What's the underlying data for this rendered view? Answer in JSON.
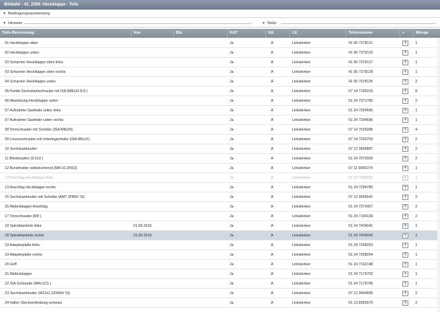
{
  "window": {
    "title": "Bildtafel - 41_2359: Heckklappe - Teile"
  },
  "sections": {
    "conditions": "Bedingungsauswertung",
    "note_left": "Hinweis",
    "note_right": "Notiz"
  },
  "columns": [
    "Teile-Benennung",
    "Von",
    "Bis",
    "KAT",
    "GE",
    "LE",
    "Teilenummer",
    "+",
    "Menge"
  ],
  "rows": [
    {
      "name": "01 Heckklappe oben",
      "von": "",
      "bis": "",
      "kat": "Ja",
      "ge": "A",
      "le": "Linkslenker",
      "nr": "41 00 7378121",
      "menge": "1"
    },
    {
      "name": "02 Heckklappe unten",
      "von": "",
      "bis": "",
      "kat": "Ja",
      "ge": "A",
      "le": "Linkslenker",
      "nr": "41 00 7379123",
      "menge": "1"
    },
    {
      "name": "03 Scharnier Heckklappe oben links",
      "von": "",
      "bis": "",
      "kat": "Ja",
      "ge": "A",
      "le": "Linkslenker",
      "nr": "41 00 7378127",
      "menge": "1"
    },
    {
      "name": "03 Scharnier Heckklappe oben rechts",
      "von": "",
      "bis": "",
      "kat": "Ja",
      "ge": "A",
      "le": "Linkslenker",
      "nr": "41 00 7378128",
      "menge": "1"
    },
    {
      "name": "04 Scharnier Heckklappe unten",
      "von": "",
      "bis": "",
      "kat": "Ja",
      "ge": "A",
      "le": "Linkslenker",
      "nr": "41 00 7378126",
      "menge": "2"
    },
    {
      "name": "05 Kombi-Sechskantschraube mit ISA (M8x32-8.8 )",
      "von": "",
      "bis": "",
      "kat": "Ja",
      "ge": "A",
      "le": "Linkslenker",
      "nr": "07 14 7195315",
      "menge": "8"
    },
    {
      "name": "06 Abstützung Heckklappe unten",
      "von": "",
      "bis": "",
      "kat": "Ja",
      "ge": "A",
      "le": "Linkslenker",
      "nr": "51 24 7371785",
      "menge": "2"
    },
    {
      "name": "07 Aufnahme Gasfeder unten links",
      "von": "",
      "bis": "",
      "kat": "Ja",
      "ge": "A",
      "le": "Linkslenker",
      "nr": "51 24 7294595",
      "menge": "1"
    },
    {
      "name": "07 Aufnahme Gasfeder unten rechts",
      "von": "",
      "bis": "",
      "kat": "Ja",
      "ge": "A",
      "le": "Linkslenker",
      "nr": "51 24 7294596",
      "menge": "1"
    },
    {
      "name": "08 Torxschraube mit Scheibe (ISA M8x20)",
      "von": "",
      "bis": "",
      "kat": "Ja",
      "ge": "A",
      "le": "Linkslenker",
      "nr": "07 14 7026396",
      "menge": "4"
    },
    {
      "name": "09 Linsenschraube mit Unterlegscheibe (ISA M6x21)",
      "von": "",
      "bis": "",
      "kat": "Ja",
      "ge": "A",
      "le": "Linkslenker",
      "nr": "07 14 7263759",
      "menge": "2"
    },
    {
      "name": "10 Sechskantmutter",
      "von": "",
      "bis": "",
      "kat": "Ja",
      "ge": "A",
      "le": "Linkslenker",
      "nr": "07 12 9906887",
      "menge": "2"
    },
    {
      "name": "11 Blindstopfen (9,5x3 )",
      "von": "",
      "bis": "",
      "kat": "Ja",
      "ge": "A",
      "le": "Linkslenker",
      "nr": "51 24 7070330",
      "menge": "2"
    },
    {
      "name": "12 Bundmutter selbstsichernd (M8-10 ZNS3)",
      "von": "",
      "bis": "",
      "kat": "Ja",
      "ge": "A",
      "le": "Linkslenker",
      "nr": "07 11 9905374",
      "menge": "1"
    },
    {
      "name": "13 Anschlag Heckklappe links",
      "von": "",
      "bis": "",
      "kat": "Ja",
      "ge": "A",
      "le": "Linkslenker",
      "nr": "51 24 7386931",
      "menge": "1",
      "disabled": true
    },
    {
      "name": "13 Anschlag Heckklappe rechts",
      "von": "",
      "bis": "",
      "kat": "Ja",
      "ge": "A",
      "le": "Linkslenker",
      "nr": "51 24 7294780",
      "menge": "1"
    },
    {
      "name": "15 Sechskantmutter mit Scheibe (AM7 ZNNIV SI)",
      "von": "",
      "bis": "",
      "kat": "Ja",
      "ge": "A",
      "le": "Linkslenker",
      "nr": "07 12 9905541",
      "menge": "2"
    },
    {
      "name": "16 Abdeckkappe Anschlag",
      "von": "",
      "bis": "",
      "kat": "Ja",
      "ge": "A",
      "le": "Linkslenker",
      "nr": "51 24 7372457",
      "menge": "2"
    },
    {
      "name": "17 Torxschraube (M8 )",
      "von": "",
      "bis": "",
      "kat": "Ja",
      "ge": "A",
      "le": "Linkslenker",
      "nr": "51 24 7194139",
      "menge": "2"
    },
    {
      "name": "18 Spindelantrieb links",
      "von": "01.09.2016",
      "bis": "",
      "kat": "Ja",
      "ge": "A",
      "le": "Linkslenker",
      "nr": "51 24 7434041",
      "menge": "1"
    },
    {
      "name": "18 Spindelantrieb rechts",
      "von": "01.09.2016",
      "bis": "",
      "kat": "Ja",
      "ge": "A",
      "le": "Linkslenker",
      "nr": "51 24 7434042",
      "menge": "1",
      "selected": true
    },
    {
      "name": "19 Adapterplatte links",
      "von": "",
      "bis": "",
      "kat": "Ja",
      "ge": "A",
      "le": "Linkslenker",
      "nr": "51 24 7308263",
      "menge": "1"
    },
    {
      "name": "19 Adapterplatte rechts",
      "von": "",
      "bis": "",
      "kat": "Ja",
      "ge": "A",
      "le": "Linkslenker",
      "nr": "51 24 7308264",
      "menge": "1"
    },
    {
      "name": "20 Griff",
      "von": "",
      "bis": "",
      "kat": "Ja",
      "ge": "A",
      "le": "Linkslenker",
      "nr": "51 24 7162148",
      "menge": "1"
    },
    {
      "name": "21 Abdeckkappe",
      "von": "",
      "bis": "",
      "kat": "Ja",
      "ge": "A",
      "le": "Linkslenker",
      "nr": "51 24 7176702",
      "menge": "1"
    },
    {
      "name": "22 ISA-Schraube (M4x13,5 )",
      "von": "",
      "bis": "",
      "kat": "Ja",
      "ge": "A",
      "le": "Linkslenker",
      "nr": "51 24 7176706",
      "menge": "1"
    },
    {
      "name": "23 Sechskantmutter (M12x1,5ZNNIV SI)",
      "von": "",
      "bis": "",
      "kat": "Ja",
      "ge": "A",
      "le": "Linkslenker",
      "nr": "07 12 9904699",
      "menge": "2"
    },
    {
      "name": "24 Halter Steckverbindung schwarz",
      "von": "",
      "bis": "",
      "kat": "Ja",
      "ge": "A",
      "le": "Linkslenker",
      "nr": "61 13 8366570",
      "menge": "2"
    }
  ]
}
